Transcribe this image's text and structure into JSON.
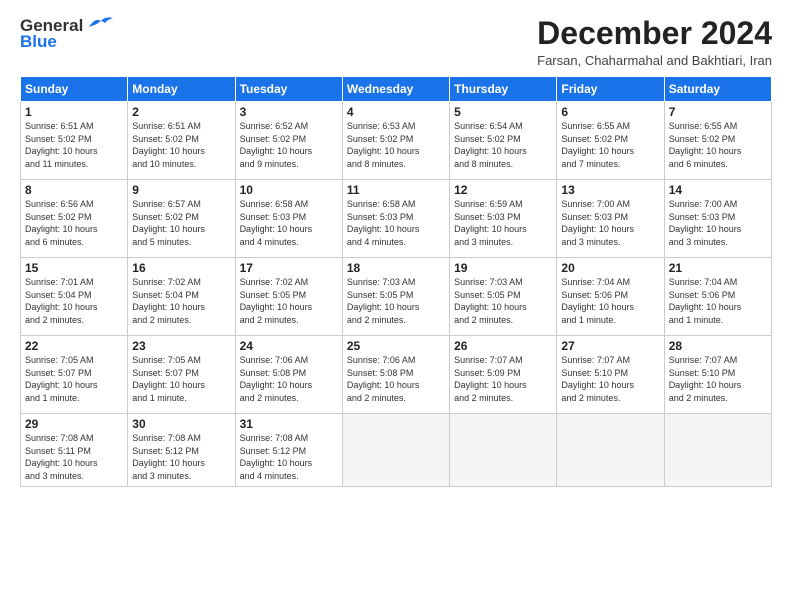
{
  "header": {
    "logo_general": "General",
    "logo_blue": "Blue",
    "month_title": "December 2024",
    "subtitle": "Farsan, Chaharmahal and Bakhtiari, Iran"
  },
  "weekdays": [
    "Sunday",
    "Monday",
    "Tuesday",
    "Wednesday",
    "Thursday",
    "Friday",
    "Saturday"
  ],
  "weeks": [
    [
      {
        "day": "1",
        "info": "Sunrise: 6:51 AM\nSunset: 5:02 PM\nDaylight: 10 hours\nand 11 minutes."
      },
      {
        "day": "2",
        "info": "Sunrise: 6:51 AM\nSunset: 5:02 PM\nDaylight: 10 hours\nand 10 minutes."
      },
      {
        "day": "3",
        "info": "Sunrise: 6:52 AM\nSunset: 5:02 PM\nDaylight: 10 hours\nand 9 minutes."
      },
      {
        "day": "4",
        "info": "Sunrise: 6:53 AM\nSunset: 5:02 PM\nDaylight: 10 hours\nand 8 minutes."
      },
      {
        "day": "5",
        "info": "Sunrise: 6:54 AM\nSunset: 5:02 PM\nDaylight: 10 hours\nand 8 minutes."
      },
      {
        "day": "6",
        "info": "Sunrise: 6:55 AM\nSunset: 5:02 PM\nDaylight: 10 hours\nand 7 minutes."
      },
      {
        "day": "7",
        "info": "Sunrise: 6:55 AM\nSunset: 5:02 PM\nDaylight: 10 hours\nand 6 minutes."
      }
    ],
    [
      {
        "day": "8",
        "info": "Sunrise: 6:56 AM\nSunset: 5:02 PM\nDaylight: 10 hours\nand 6 minutes."
      },
      {
        "day": "9",
        "info": "Sunrise: 6:57 AM\nSunset: 5:02 PM\nDaylight: 10 hours\nand 5 minutes."
      },
      {
        "day": "10",
        "info": "Sunrise: 6:58 AM\nSunset: 5:03 PM\nDaylight: 10 hours\nand 4 minutes."
      },
      {
        "day": "11",
        "info": "Sunrise: 6:58 AM\nSunset: 5:03 PM\nDaylight: 10 hours\nand 4 minutes."
      },
      {
        "day": "12",
        "info": "Sunrise: 6:59 AM\nSunset: 5:03 PM\nDaylight: 10 hours\nand 3 minutes."
      },
      {
        "day": "13",
        "info": "Sunrise: 7:00 AM\nSunset: 5:03 PM\nDaylight: 10 hours\nand 3 minutes."
      },
      {
        "day": "14",
        "info": "Sunrise: 7:00 AM\nSunset: 5:03 PM\nDaylight: 10 hours\nand 3 minutes."
      }
    ],
    [
      {
        "day": "15",
        "info": "Sunrise: 7:01 AM\nSunset: 5:04 PM\nDaylight: 10 hours\nand 2 minutes."
      },
      {
        "day": "16",
        "info": "Sunrise: 7:02 AM\nSunset: 5:04 PM\nDaylight: 10 hours\nand 2 minutes."
      },
      {
        "day": "17",
        "info": "Sunrise: 7:02 AM\nSunset: 5:05 PM\nDaylight: 10 hours\nand 2 minutes."
      },
      {
        "day": "18",
        "info": "Sunrise: 7:03 AM\nSunset: 5:05 PM\nDaylight: 10 hours\nand 2 minutes."
      },
      {
        "day": "19",
        "info": "Sunrise: 7:03 AM\nSunset: 5:05 PM\nDaylight: 10 hours\nand 2 minutes."
      },
      {
        "day": "20",
        "info": "Sunrise: 7:04 AM\nSunset: 5:06 PM\nDaylight: 10 hours\nand 1 minute."
      },
      {
        "day": "21",
        "info": "Sunrise: 7:04 AM\nSunset: 5:06 PM\nDaylight: 10 hours\nand 1 minute."
      }
    ],
    [
      {
        "day": "22",
        "info": "Sunrise: 7:05 AM\nSunset: 5:07 PM\nDaylight: 10 hours\nand 1 minute."
      },
      {
        "day": "23",
        "info": "Sunrise: 7:05 AM\nSunset: 5:07 PM\nDaylight: 10 hours\nand 1 minute."
      },
      {
        "day": "24",
        "info": "Sunrise: 7:06 AM\nSunset: 5:08 PM\nDaylight: 10 hours\nand 2 minutes."
      },
      {
        "day": "25",
        "info": "Sunrise: 7:06 AM\nSunset: 5:08 PM\nDaylight: 10 hours\nand 2 minutes."
      },
      {
        "day": "26",
        "info": "Sunrise: 7:07 AM\nSunset: 5:09 PM\nDaylight: 10 hours\nand 2 minutes."
      },
      {
        "day": "27",
        "info": "Sunrise: 7:07 AM\nSunset: 5:10 PM\nDaylight: 10 hours\nand 2 minutes."
      },
      {
        "day": "28",
        "info": "Sunrise: 7:07 AM\nSunset: 5:10 PM\nDaylight: 10 hours\nand 2 minutes."
      }
    ],
    [
      {
        "day": "29",
        "info": "Sunrise: 7:08 AM\nSunset: 5:11 PM\nDaylight: 10 hours\nand 3 minutes."
      },
      {
        "day": "30",
        "info": "Sunrise: 7:08 AM\nSunset: 5:12 PM\nDaylight: 10 hours\nand 3 minutes."
      },
      {
        "day": "31",
        "info": "Sunrise: 7:08 AM\nSunset: 5:12 PM\nDaylight: 10 hours\nand 4 minutes."
      },
      {
        "day": "",
        "info": ""
      },
      {
        "day": "",
        "info": ""
      },
      {
        "day": "",
        "info": ""
      },
      {
        "day": "",
        "info": ""
      }
    ]
  ]
}
